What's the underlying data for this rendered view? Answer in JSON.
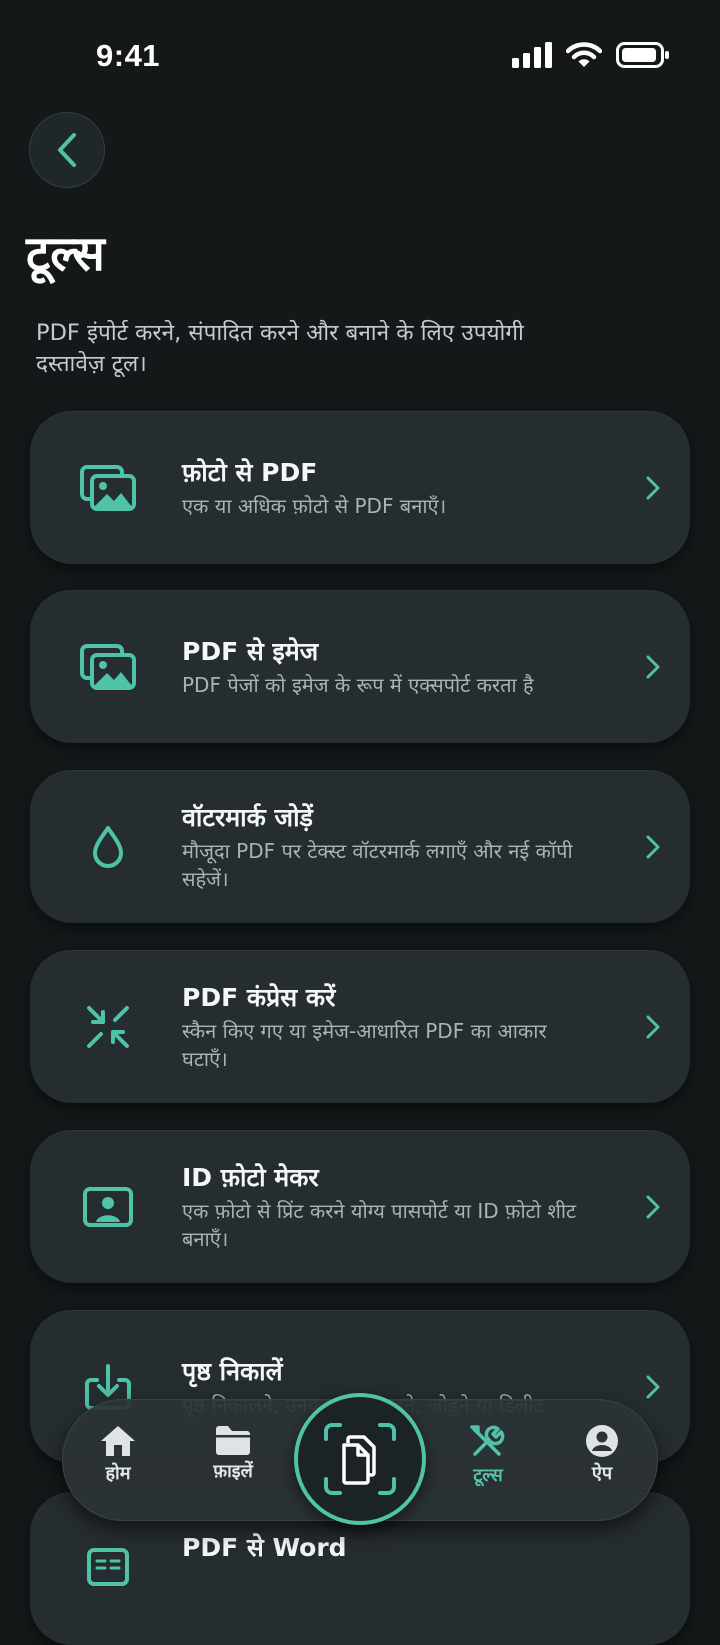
{
  "status_bar": {
    "time": "9:41"
  },
  "header": {
    "title": "टूल्स",
    "subtitle": "PDF इंपोर्ट करने, संपादित करने और बनाने के लिए उपयोगी दस्तावेज़ टूल।"
  },
  "tools": [
    {
      "title": "फ़ोटो से PDF",
      "description": "एक या अधिक फ़ोटो से PDF बनाएँ।",
      "icon": "photos-icon"
    },
    {
      "title": "PDF से इमेज",
      "description": "PDF पेजों को इमेज के रूप में एक्सपोर्ट करता है",
      "icon": "images-icon"
    },
    {
      "title": "वॉटरमार्क जोड़ें",
      "description": "मौजूदा PDF पर टेक्स्ट वॉटरमार्क लगाएँ और नई कॉपी सहेजें।",
      "icon": "droplet-icon"
    },
    {
      "title": "PDF कंप्रेस करें",
      "description": "स्कैन किए गए या इमेज-आधारित PDF का आकार घटाएँ।",
      "icon": "compress-icon"
    },
    {
      "title": "ID फ़ोटो मेकर",
      "description": "एक फ़ोटो से प्रिंट करने योग्य पासपोर्ट या ID फ़ोटो शीट बनाएँ।",
      "icon": "id-card-icon"
    },
    {
      "title": "पृष्ठ निकालें",
      "description": "पृष्ठ निकालने, उनका क्रम बदलने, जोड़ने या डिलीट",
      "icon": "extract-icon"
    },
    {
      "title": "PDF से Word",
      "description": "",
      "icon": "word-icon"
    }
  ],
  "nav": {
    "home": "होम",
    "files": "फ़ाइलें",
    "tools": "टूल्स",
    "app": "ऐप"
  },
  "colors": {
    "accent": "#4fc3a6",
    "background": "#141819",
    "card": "#262d31"
  }
}
